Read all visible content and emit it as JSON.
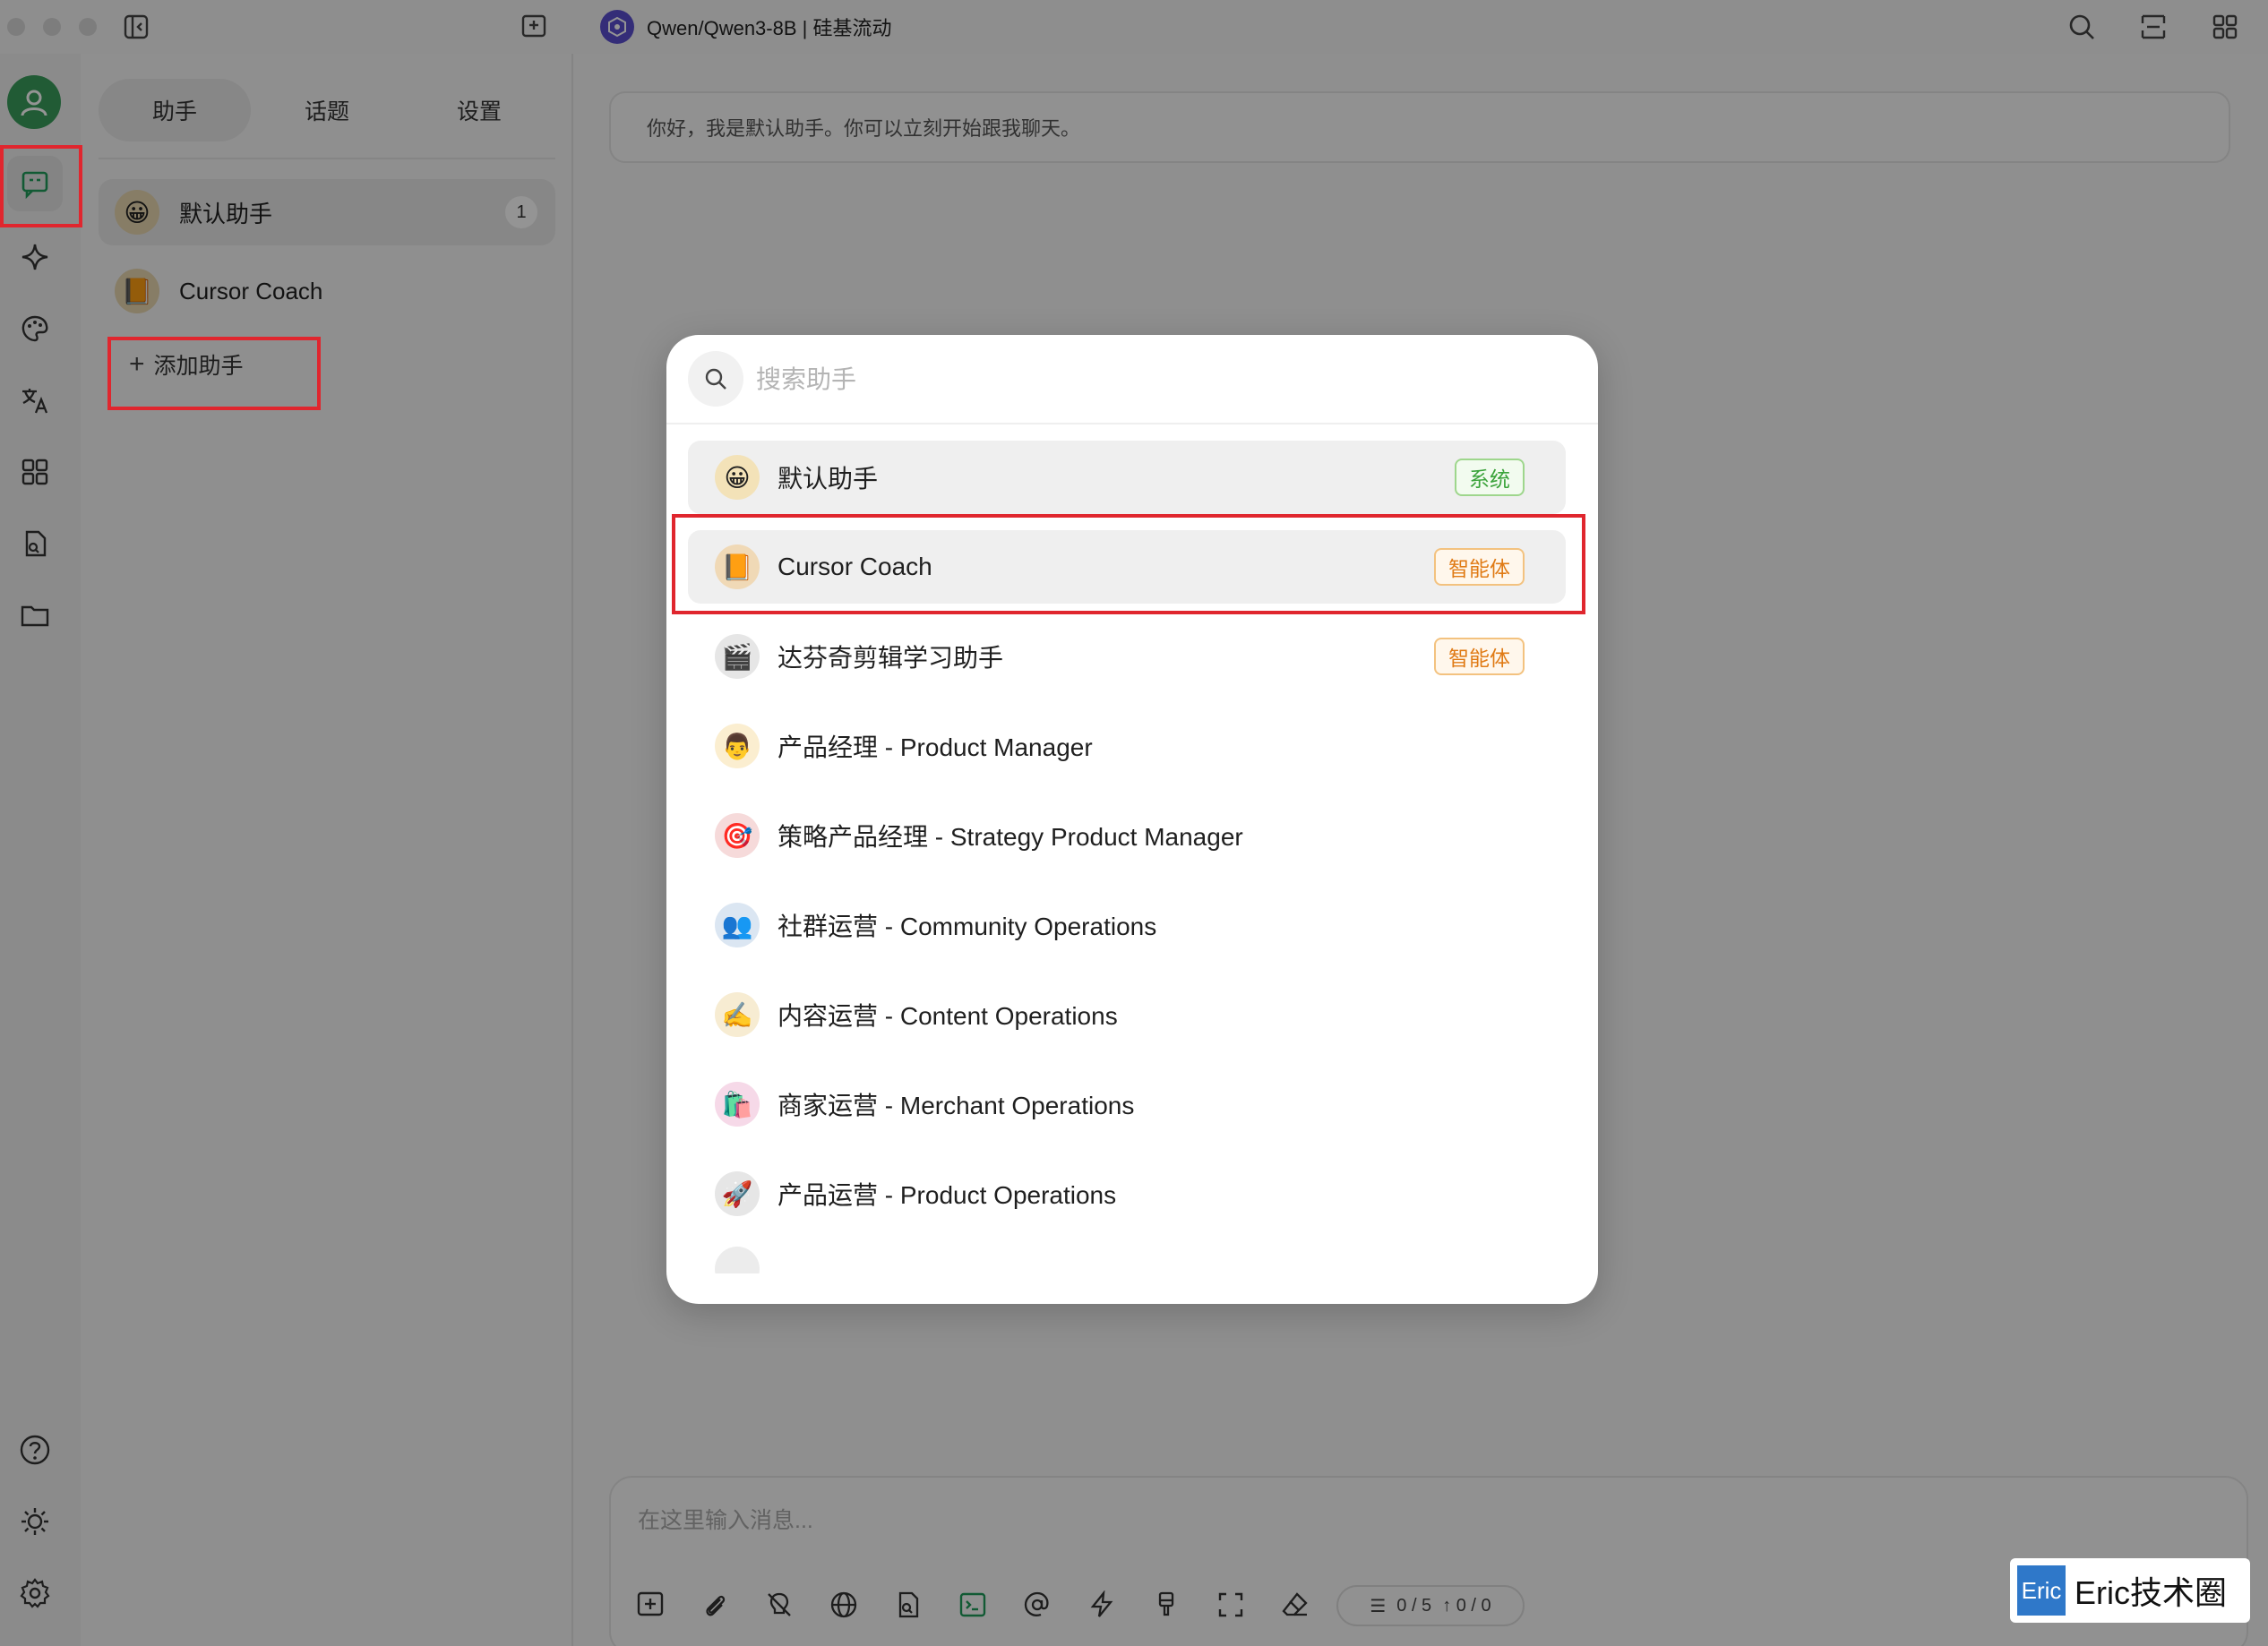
{
  "window": {
    "model_title": "Qwen/Qwen3-8B | 硅基流动"
  },
  "left_panel": {
    "tabs": [
      {
        "label": "助手",
        "active": true
      },
      {
        "label": "话题",
        "active": false
      },
      {
        "label": "设置",
        "active": false
      }
    ],
    "assistants": [
      {
        "emoji": "😀",
        "name": "默认助手",
        "count": "1"
      },
      {
        "emoji": "📙",
        "name": "Cursor Coach"
      }
    ],
    "add_label": "添加助手"
  },
  "main": {
    "greeting": "你好，我是默认助手。你可以立刻开始跟我聊天。",
    "input_placeholder": "在这里输入消息...",
    "tokens_context": "0 / 5",
    "tokens_count": "↑ 0 / 0"
  },
  "modal": {
    "search_placeholder": "搜索助手",
    "items": [
      {
        "emoji": "😀",
        "name": "默认助手",
        "badge": "系统",
        "badge_type": "sys"
      },
      {
        "emoji": "📙",
        "name": "Cursor Coach",
        "badge": "智能体",
        "badge_type": "agent"
      },
      {
        "emoji": "🎬",
        "name": "达芬奇剪辑学习助手",
        "badge": "智能体",
        "badge_type": "agent"
      },
      {
        "emoji": "👨",
        "name": "产品经理 - Product Manager"
      },
      {
        "emoji": "🎯",
        "name": "策略产品经理 - Strategy Product Manager"
      },
      {
        "emoji": "👥",
        "name": "社群运营 - Community Operations"
      },
      {
        "emoji": "✍️",
        "name": "内容运营 - Content Operations"
      },
      {
        "emoji": "🛍️",
        "name": "商家运营 - Merchant Operations"
      },
      {
        "emoji": "🚀",
        "name": "产品运营 - Product Operations"
      }
    ]
  },
  "watermark": {
    "logo": "Eric",
    "text": "Eric技术圈"
  },
  "colors": {
    "highlight_red": "#e0262e",
    "system_green": "#3aa33a",
    "agent_orange": "#e07b16"
  }
}
